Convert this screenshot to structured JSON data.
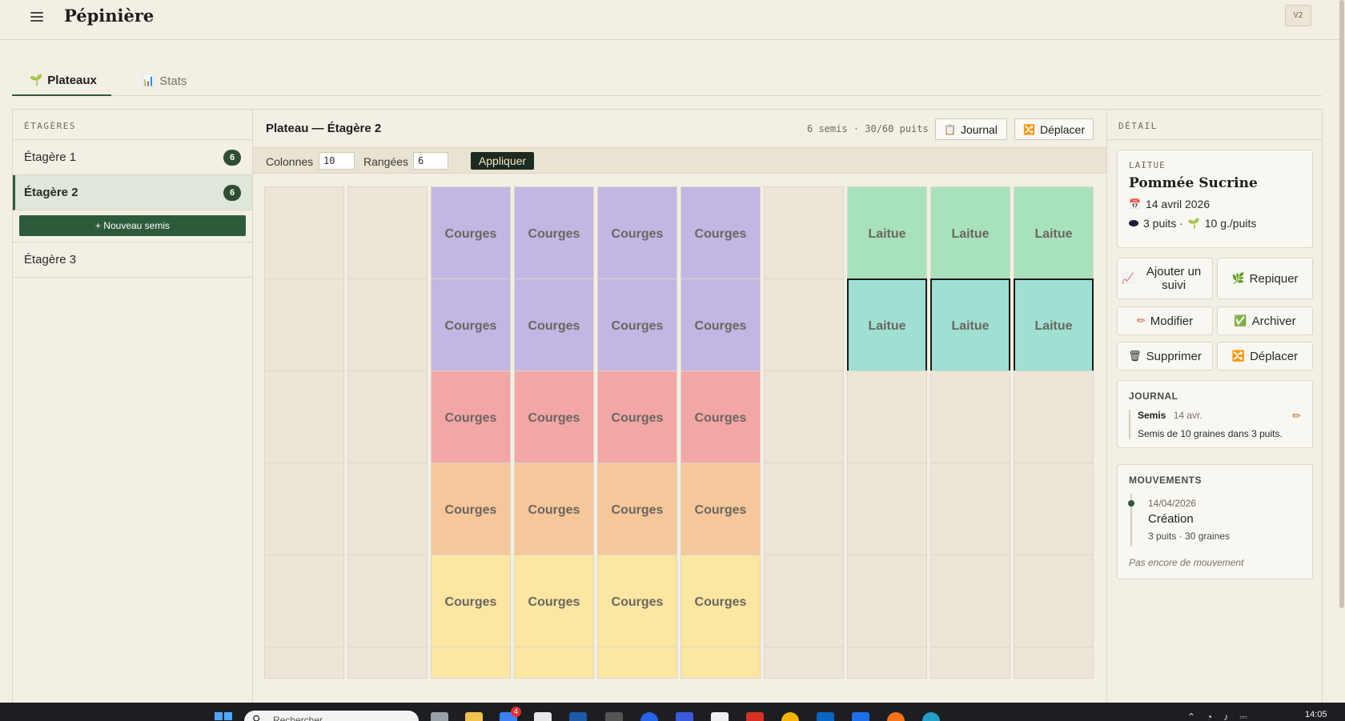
{
  "app": {
    "title": "Pépinière",
    "version": "V2"
  },
  "tabs": [
    {
      "label": "Plateaux",
      "icon": "seedling-icon",
      "active": true
    },
    {
      "label": "Stats",
      "icon": "bar-chart-icon",
      "active": false
    }
  ],
  "shelves": {
    "header": "ÉTAGÈRES",
    "items": [
      {
        "label": "Étagère 1",
        "count": "6",
        "active": false
      },
      {
        "label": "Étagère 2",
        "count": "6",
        "active": true
      },
      {
        "label": "Étagère 3",
        "count": "",
        "active": false
      }
    ],
    "new_seed_label": "+ Nouveau semis"
  },
  "plateau": {
    "title": "Plateau — Étagère 2",
    "stats": "6 semis · 30/60 puits",
    "journal_label": "Journal",
    "move_label": "Déplacer",
    "columns_label": "Colonnes",
    "columns_value": "10",
    "rows_label": "Rangées",
    "rows_value": "6",
    "apply_label": "Appliquer"
  },
  "grid": {
    "columns": 10,
    "rows_visible": 6,
    "cells": [
      [
        "",
        "",
        "Courges",
        "Courges",
        "Courges",
        "Courges",
        "",
        "Laitue",
        "Laitue",
        "Laitue"
      ],
      [
        "",
        "",
        "Courges",
        "Courges",
        "Courges",
        "Courges",
        "",
        "Laitue",
        "Laitue",
        "Laitue"
      ],
      [
        "",
        "",
        "Courges",
        "Courges",
        "Courges",
        "Courges",
        "",
        "",
        "",
        ""
      ],
      [
        "",
        "",
        "Courges",
        "Courges",
        "Courges",
        "Courges",
        "",
        "",
        "",
        ""
      ],
      [
        "",
        "",
        "Courges",
        "Courges",
        "Courges",
        "Courges",
        "",
        "",
        "",
        ""
      ],
      [
        "",
        "",
        "",
        "",
        "",
        "",
        "",
        "",
        "",
        ""
      ]
    ],
    "row_colors": [
      [
        "#ece6d8",
        "#ece6d8",
        "#c3b6e2",
        "#c3b6e2",
        "#c3b6e2",
        "#c3b6e2",
        "#ece6d8",
        "#a8e2bd",
        "#a8e2bd",
        "#a8e2bd"
      ],
      [
        "#ece6d8",
        "#ece6d8",
        "#c3b6e2",
        "#c3b6e2",
        "#c3b6e2",
        "#c3b6e2",
        "#ece6d8",
        "#9fe0d3",
        "#9fe0d3",
        "#9fe0d3"
      ],
      [
        "#ece6d8",
        "#ece6d8",
        "#f2a6a6",
        "#f2a6a6",
        "#f2a6a6",
        "#f2a6a6",
        "#ece6d8",
        "#ece6d8",
        "#ece6d8",
        "#ece6d8"
      ],
      [
        "#ece6d8",
        "#ece6d8",
        "#f6c79a",
        "#f6c79a",
        "#f6c79a",
        "#f6c79a",
        "#ece6d8",
        "#ece6d8",
        "#ece6d8",
        "#ece6d8"
      ],
      [
        "#ece6d8",
        "#ece6d8",
        "#fbe6a2",
        "#fbe6a2",
        "#fbe6a2",
        "#fbe6a2",
        "#ece6d8",
        "#ece6d8",
        "#ece6d8",
        "#ece6d8"
      ],
      [
        "#ece6d8",
        "#ece6d8",
        "#fbe6a2",
        "#fbe6a2",
        "#fbe6a2",
        "#fbe6a2",
        "#ece6d8",
        "#ece6d8",
        "#ece6d8",
        "#ece6d8"
      ]
    ],
    "selected": [
      [
        1,
        7
      ],
      [
        1,
        8
      ],
      [
        1,
        9
      ]
    ]
  },
  "detail": {
    "header": "DÉTAIL",
    "crop_type": "LAITUE",
    "variety": "Pommée Sucrine",
    "date": "14 avril 2026",
    "wells": "3 puits ·",
    "seeds_per_well": "10 g./puits",
    "actions": {
      "add_followup": "Ajouter un suivi",
      "transplant": "Repiquer",
      "edit": "Modifier",
      "archive": "Archiver",
      "delete": "Supprimer",
      "move": "Déplacer"
    },
    "journal": {
      "title": "JOURNAL",
      "entry_type": "Semis",
      "entry_date": "14 avr.",
      "entry_text": "Semis de 10 graines dans 3 puits."
    },
    "movements": {
      "title": "MOUVEMENTS",
      "date": "14/04/2026",
      "event": "Création",
      "info": "3 puits · 30 graines",
      "empty_note": "Pas encore de mouvement"
    }
  },
  "taskbar": {
    "search_placeholder": "Rechercher",
    "notification_count": "4",
    "clock": "14:05"
  }
}
